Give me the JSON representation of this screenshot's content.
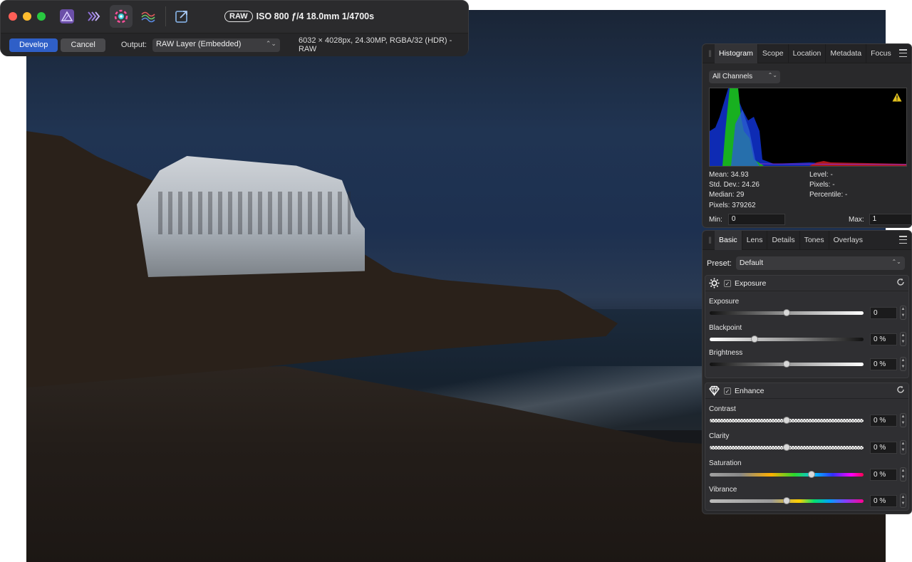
{
  "toolbar": {
    "raw_badge": "RAW",
    "exif": "ISO 800 ƒ/4 18.0mm 1/4700s",
    "develop_label": "Develop",
    "cancel_label": "Cancel",
    "output_label": "Output:",
    "output_value": "RAW Layer (Embedded)",
    "image_info": "6032 × 4028px, 24.30MP, RGBA/32 (HDR) - RAW",
    "colors": {
      "close": "#ff5f57",
      "minimize": "#febc2e",
      "zoom": "#28c840",
      "accent": "#2f5fc7"
    }
  },
  "histogram_panel": {
    "tabs": [
      "Histogram",
      "Scope",
      "Location",
      "Metadata",
      "Focus"
    ],
    "active_tab": "Histogram",
    "channels": "All Channels",
    "stats_left": [
      "Mean: 34.93",
      "Std. Dev.: 24.26",
      "Median: 29",
      "Pixels: 379262"
    ],
    "stats_right": [
      "Level: -",
      "Pixels: -",
      "Percentile: -"
    ],
    "min_label": "Min:",
    "min_value": "0",
    "max_label": "Max:",
    "max_value": "1"
  },
  "develop_panel": {
    "tabs": [
      "Basic",
      "Lens",
      "Details",
      "Tones",
      "Overlays"
    ],
    "active_tab": "Basic",
    "preset_label": "Preset:",
    "preset_value": "Default",
    "exposure_section": {
      "title": "Exposure",
      "controls": [
        {
          "label": "Exposure",
          "value": "0",
          "level": 0.5
        },
        {
          "label": "Blackpoint",
          "value": "0 %",
          "level": 0.29
        },
        {
          "label": "Brightness",
          "value": "0 %",
          "level": 0.5
        }
      ]
    },
    "enhance_section": {
      "title": "Enhance",
      "controls": [
        {
          "label": "Contrast",
          "value": "0 %",
          "level": 0.5
        },
        {
          "label": "Clarity",
          "value": "0 %",
          "level": 0.5
        },
        {
          "label": "Saturation",
          "value": "0 %",
          "level": 0.66
        },
        {
          "label": "Vibrance",
          "value": "0 %",
          "level": 0.5
        }
      ]
    }
  }
}
